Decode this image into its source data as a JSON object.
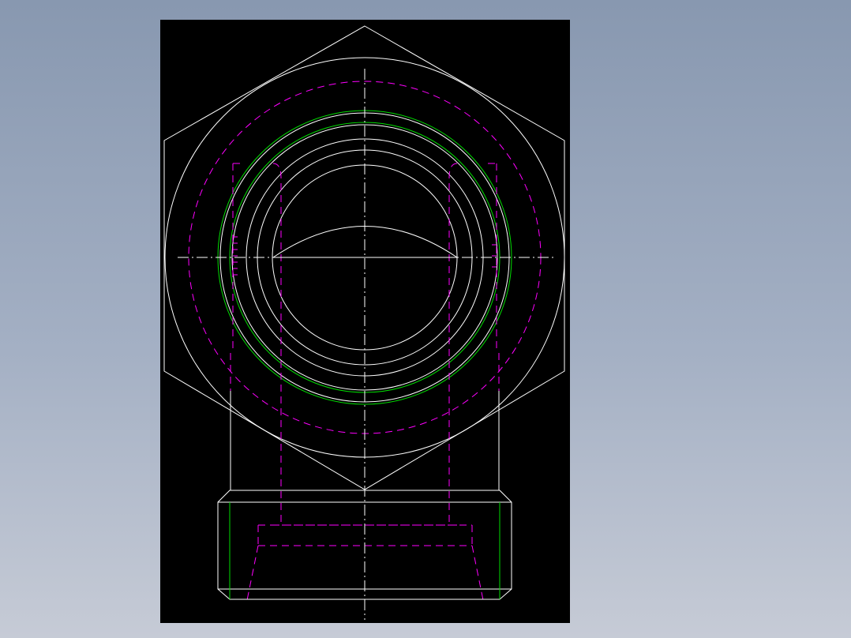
{
  "drawing": {
    "background": "#000000",
    "colors": {
      "outline": "#ffffff",
      "hidden": "#ff00ff",
      "thread": "#00dd00",
      "centerline": "#ffffff"
    },
    "view": "cad-fitting-front-view"
  }
}
